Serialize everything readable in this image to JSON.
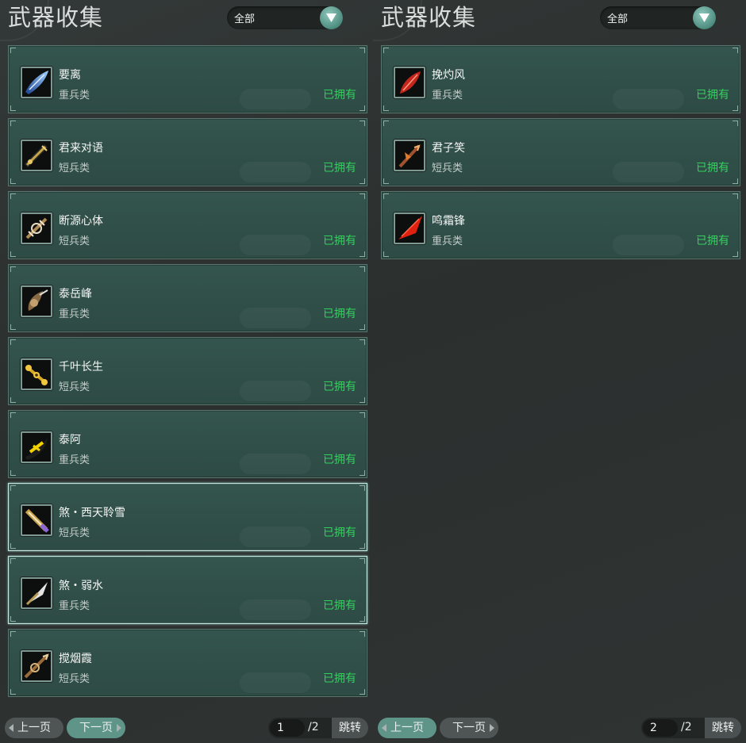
{
  "panels": [
    {
      "title": "武器收集",
      "filter": {
        "selected": "全部"
      },
      "items": [
        {
          "name": "要离",
          "type": "重兵类",
          "status": "已拥有",
          "icon": "blue-blade-icon",
          "selected": false
        },
        {
          "name": "君来对语",
          "type": "短兵类",
          "status": "已拥有",
          "icon": "gold-dagger-icon",
          "selected": false
        },
        {
          "name": "断源心体",
          "type": "短兵类",
          "status": "已拥有",
          "icon": "ornate-spear-icon",
          "selected": false
        },
        {
          "name": "泰岳峰",
          "type": "重兵类",
          "status": "已拥有",
          "icon": "bronze-blade-icon",
          "selected": false
        },
        {
          "name": "千叶长生",
          "type": "短兵类",
          "status": "已拥有",
          "icon": "gold-chain-icon",
          "selected": false
        },
        {
          "name": "泰阿",
          "type": "重兵类",
          "status": "已拥有",
          "icon": "yellow-blade-icon",
          "selected": false
        },
        {
          "name": "煞・西天聆雪",
          "type": "短兵类",
          "status": "已拥有",
          "icon": "violet-dagger-icon",
          "selected": true
        },
        {
          "name": "煞・弱水",
          "type": "重兵类",
          "status": "已拥有",
          "icon": "steel-blade-icon",
          "selected": true
        },
        {
          "name": "搅烟霞",
          "type": "短兵类",
          "status": "已拥有",
          "icon": "copper-spear-icon",
          "selected": false
        }
      ],
      "pager": {
        "prev": "上一页",
        "next": "下一页",
        "page": "1",
        "total": "/2",
        "jump": "跳转",
        "active": "next"
      }
    },
    {
      "title": "武器收集",
      "filter": {
        "selected": "全部"
      },
      "items": [
        {
          "name": "挽灼风",
          "type": "重兵类",
          "status": "已拥有",
          "icon": "red-crystal-blade-icon",
          "selected": false
        },
        {
          "name": "君子笑",
          "type": "短兵类",
          "status": "已拥有",
          "icon": "flame-dagger-icon",
          "selected": false
        },
        {
          "name": "鸣霜锋",
          "type": "重兵类",
          "status": "已拥有",
          "icon": "crimson-blade-icon",
          "selected": false
        }
      ],
      "pager": {
        "prev": "上一页",
        "next": "下一页",
        "page": "2",
        "total": "/2",
        "jump": "跳转",
        "active": "prev"
      }
    }
  ],
  "colors": {
    "owned": "#2fd35a",
    "card": "#34544e",
    "accent": "#5f9589",
    "background": "#2d3130"
  }
}
